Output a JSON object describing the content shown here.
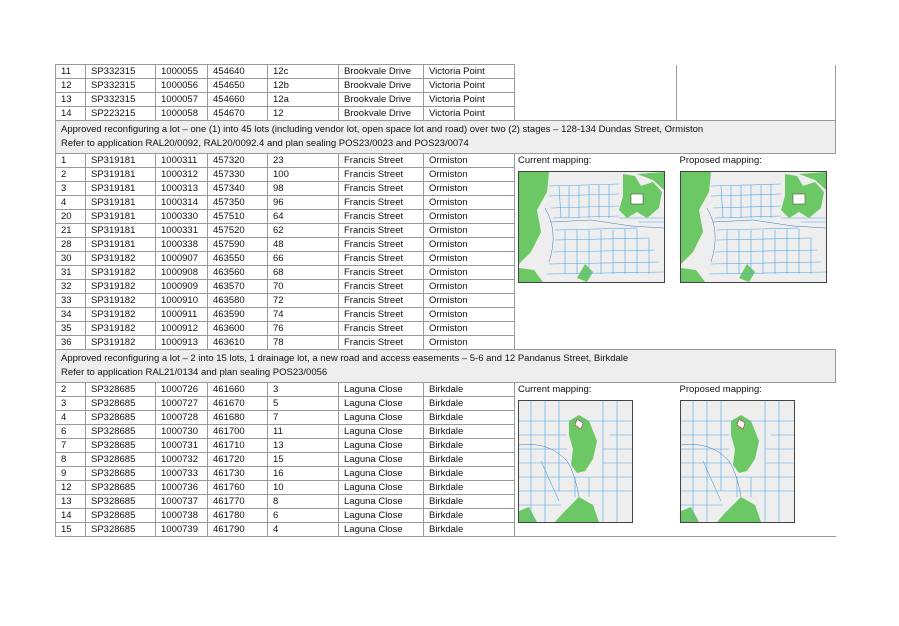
{
  "section_top": {
    "rows": [
      [
        "11",
        "SP332315",
        "1000055",
        "454640",
        "12c",
        "Brookvale Drive",
        "Victoria Point"
      ],
      [
        "12",
        "SP332315",
        "1000056",
        "454650",
        "12b",
        "Brookvale Drive",
        "Victoria Point"
      ],
      [
        "13",
        "SP332315",
        "1000057",
        "454660",
        "12a",
        "Brookvale Drive",
        "Victoria Point"
      ],
      [
        "14",
        "SP223215",
        "1000058",
        "454670",
        "12",
        "Brookvale Drive",
        "Victoria Point"
      ]
    ]
  },
  "section_ormiston": {
    "header_line1": "Approved reconfiguring a lot –  one (1) into 45 lots (including vendor lot, open space lot and road) over two (2) stages – 128-134 Dundas Street, Ormiston",
    "header_line2": "Refer to application RAL20/0092, RAL20/0092.4 and plan sealing POS23/0023 and POS23/0074",
    "current_label": "Current mapping:",
    "proposed_label": "Proposed mapping:",
    "rows": [
      [
        "1",
        "SP319181",
        "1000311",
        "457320",
        "23",
        "Francis Street",
        "Ormiston"
      ],
      [
        "2",
        "SP319181",
        "1000312",
        "457330",
        "100",
        "Francis Street",
        "Ormiston"
      ],
      [
        "3",
        "SP319181",
        "1000313",
        "457340",
        "98",
        "Francis Street",
        "Ormiston"
      ],
      [
        "4",
        "SP319181",
        "1000314",
        "457350",
        "96",
        "Francis Street",
        "Ormiston"
      ],
      [
        "20",
        "SP319181",
        "1000330",
        "457510",
        "64",
        "Francis Street",
        "Ormiston"
      ],
      [
        "21",
        "SP319181",
        "1000331",
        "457520",
        "62",
        "Francis Street",
        "Ormiston"
      ],
      [
        "28",
        "SP319181",
        "1000338",
        "457590",
        "48",
        "Francis Street",
        "Ormiston"
      ],
      [
        "30",
        "SP319182",
        "1000907",
        "463550",
        "66",
        "Francis Street",
        "Ormiston"
      ],
      [
        "31",
        "SP319182",
        "1000908",
        "463560",
        "68",
        "Francis Street",
        "Ormiston"
      ],
      [
        "32",
        "SP319182",
        "1000909",
        "463570",
        "70",
        "Francis Street",
        "Ormiston"
      ],
      [
        "33",
        "SP319182",
        "1000910",
        "463580",
        "72",
        "Francis Street",
        "Ormiston"
      ],
      [
        "34",
        "SP319182",
        "1000911",
        "463590",
        "74",
        "Francis Street",
        "Ormiston"
      ],
      [
        "35",
        "SP319182",
        "1000912",
        "463600",
        "76",
        "Francis Street",
        "Ormiston"
      ],
      [
        "36",
        "SP319182",
        "1000913",
        "463610",
        "78",
        "Francis Street",
        "Ormiston"
      ]
    ]
  },
  "section_birkdale": {
    "header_line1": "Approved reconfiguring a lot – 2 into 15 lots, 1 drainage lot, a new road and access easements – 5-6 and 12 Pandanus Street, Birkdale",
    "header_line2": "Refer to application RAL21/0134 and plan sealing POS23/0056",
    "current_label": "Current mapping:",
    "proposed_label": "Proposed mapping:",
    "rows": [
      [
        "2",
        "SP328685",
        "1000726",
        "461660",
        "3",
        "Laguna Close",
        "Birkdale"
      ],
      [
        "3",
        "SP328685",
        "1000727",
        "461670",
        "5",
        "Laguna Close",
        "Birkdale"
      ],
      [
        "4",
        "SP328685",
        "1000728",
        "461680",
        "7",
        "Laguna Close",
        "Birkdale"
      ],
      [
        "6",
        "SP328685",
        "1000730",
        "461700",
        "11",
        "Laguna Close",
        "Birkdale"
      ],
      [
        "7",
        "SP328685",
        "1000731",
        "461710",
        "13",
        "Laguna Close",
        "Birkdale"
      ],
      [
        "8",
        "SP328685",
        "1000732",
        "461720",
        "15",
        "Laguna Close",
        "Birkdale"
      ],
      [
        "9",
        "SP328685",
        "1000733",
        "461730",
        "16",
        "Laguna Close",
        "Birkdale"
      ],
      [
        "12",
        "SP328685",
        "1000736",
        "461760",
        "10",
        "Laguna Close",
        "Birkdale"
      ],
      [
        "13",
        "SP328685",
        "1000737",
        "461770",
        "8",
        "Laguna Close",
        "Birkdale"
      ],
      [
        "14",
        "SP328685",
        "1000738",
        "461780",
        "6",
        "Laguna Close",
        "Birkdale"
      ],
      [
        "15",
        "SP328685",
        "1000739",
        "461790",
        "4",
        "Laguna Close",
        "Birkdale"
      ]
    ]
  },
  "colors": {
    "map_land": "#eeeeee",
    "map_green": "#6cc864",
    "map_lines": "#4fa8e6",
    "header_bg": "#eeeeee",
    "border": "#999999"
  }
}
